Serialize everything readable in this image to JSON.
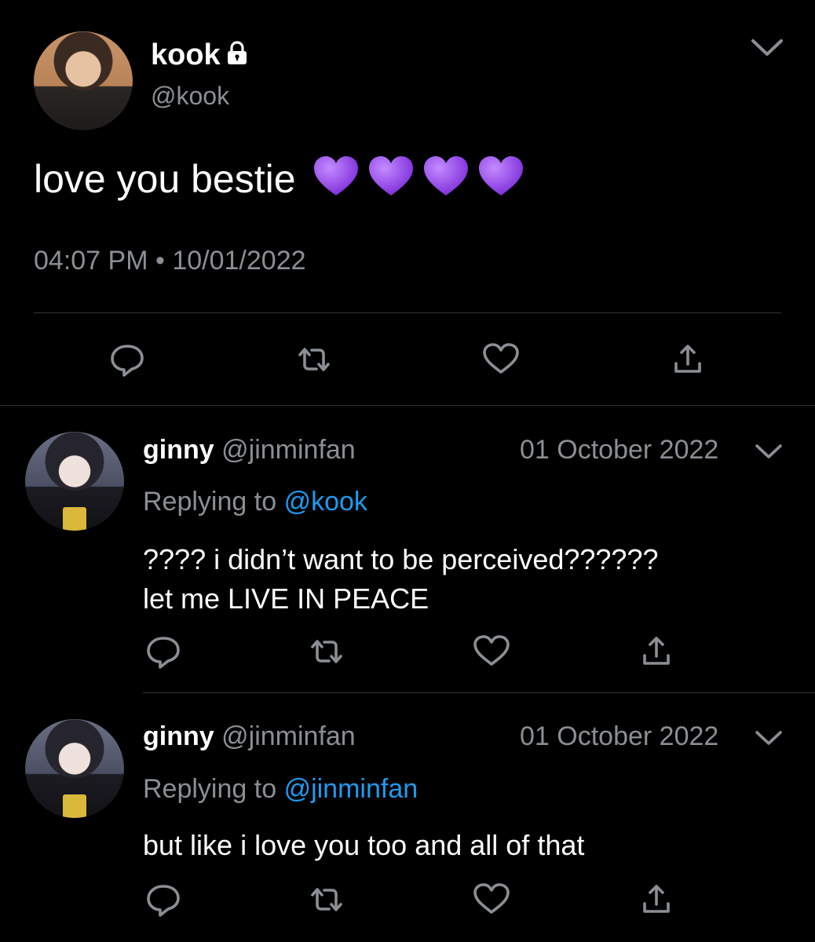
{
  "main_tweet": {
    "display_name": "kook",
    "handle": "@kook",
    "text": "love you bestie",
    "emoji": [
      "purple-heart",
      "purple-heart",
      "purple-heart",
      "purple-heart"
    ],
    "time": "04:07 PM",
    "separator": "•",
    "date": "10/01/2022"
  },
  "replies": [
    {
      "display_name": "ginny",
      "handle": "@jinminfan",
      "date": "01 October 2022",
      "replying_prefix": "Replying to",
      "replying_to": "@kook",
      "text_lines": [
        "???? i didn’t want to be perceived??????",
        "let me LIVE IN PEACE"
      ]
    },
    {
      "display_name": "ginny",
      "handle": "@jinminfan",
      "date": "01 October 2022",
      "replying_prefix": "Replying to",
      "replying_to": "@jinminfan",
      "text_lines": [
        "but like i love you too and all of that"
      ]
    }
  ],
  "icons": {
    "lock": "lock-icon",
    "chevron": "chevron-down-icon",
    "reply": "reply-icon",
    "retweet": "retweet-icon",
    "like": "heart-icon",
    "share": "share-icon"
  },
  "colors": {
    "background": "#000000",
    "text": "#e7e9ea",
    "muted": "#8b8f94",
    "link": "#1d9bf0",
    "divider": "#2f3336",
    "purple_heart": "#9b4cf0"
  }
}
